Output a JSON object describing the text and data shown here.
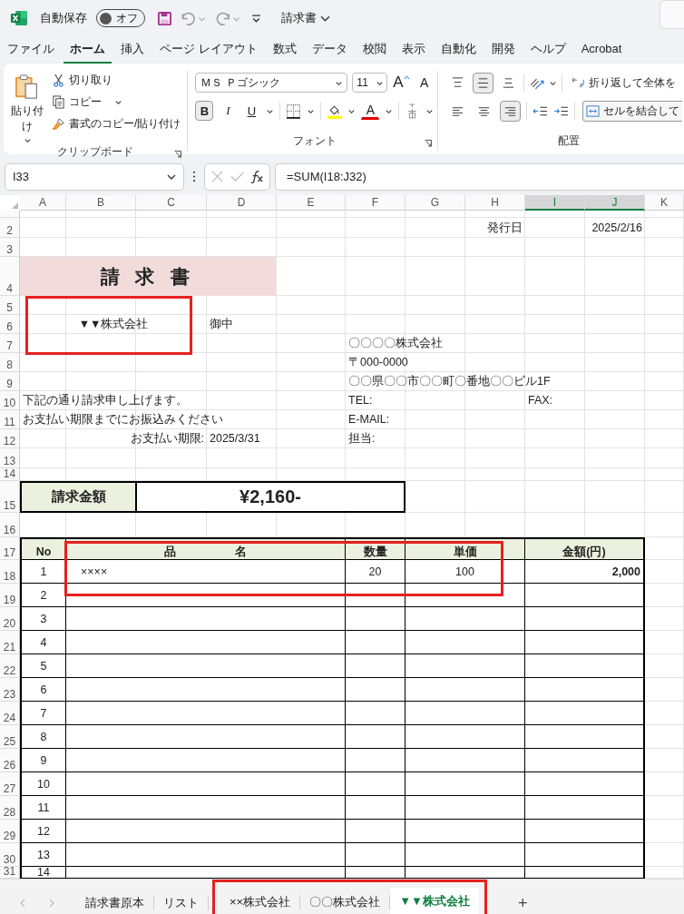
{
  "title_bar": {
    "autosave_label": "自動保存",
    "autosave": {
      "label": "オフ",
      "on": false
    },
    "document_title": "請求書"
  },
  "menu_tabs": [
    {
      "label": "ファイル",
      "selected": false
    },
    {
      "label": "ホーム",
      "selected": true
    },
    {
      "label": "挿入",
      "selected": false
    },
    {
      "label": "ページ レイアウト",
      "selected": false
    },
    {
      "label": "数式",
      "selected": false
    },
    {
      "label": "データ",
      "selected": false
    },
    {
      "label": "校閲",
      "selected": false
    },
    {
      "label": "表示",
      "selected": false
    },
    {
      "label": "自動化",
      "selected": false
    },
    {
      "label": "開発",
      "selected": false
    },
    {
      "label": "ヘルプ",
      "selected": false
    },
    {
      "label": "Acrobat",
      "selected": false
    }
  ],
  "ribbon": {
    "clipboard": {
      "paste": "貼り付け",
      "cut": "切り取り",
      "copy": "コピー",
      "format_painter": "書式のコピー/貼り付け",
      "label": "クリップボード"
    },
    "font": {
      "name": "ＭＳ Ｐゴシック",
      "size": "11",
      "grow": "A",
      "shrink": "A",
      "font_color": "A",
      "label": "フォント",
      "styles": [
        {
          "kind": "bold",
          "label": "B",
          "selected": true
        },
        {
          "kind": "italic",
          "label": "I",
          "selected": false
        },
        {
          "kind": "underline",
          "label": "U",
          "selected": false
        }
      ]
    },
    "alignment": {
      "vertical": [
        {
          "kind": "top",
          "selected": false
        },
        {
          "kind": "middle",
          "selected": true
        },
        {
          "kind": "bottom",
          "selected": false
        }
      ],
      "horizontal": [
        {
          "kind": "left",
          "selected": false
        },
        {
          "kind": "center",
          "selected": false
        },
        {
          "kind": "right",
          "selected": true
        }
      ],
      "wrap_text": "折り返して全体を",
      "merge_center": "セルを結合して",
      "label": "配置"
    }
  },
  "formula_bar": {
    "name_box": "I33",
    "formula": "=SUM(I18:J32)"
  },
  "sheet": {
    "columns": [
      {
        "label": "A",
        "selected": false
      },
      {
        "label": "B",
        "selected": false
      },
      {
        "label": "C",
        "selected": false
      },
      {
        "label": "D",
        "selected": false
      },
      {
        "label": "E",
        "selected": false
      },
      {
        "label": "F",
        "selected": false
      },
      {
        "label": "G",
        "selected": false
      },
      {
        "label": "H",
        "selected": false
      },
      {
        "label": "I",
        "selected": true
      },
      {
        "label": "J",
        "selected": true
      },
      {
        "label": "K",
        "selected": false
      }
    ],
    "rows": [
      "2",
      "3",
      "4",
      "5",
      "6",
      "7",
      "8",
      "9",
      "10",
      "11",
      "12",
      "13",
      "14",
      "15",
      "16",
      "17",
      "18",
      "19",
      "20",
      "21",
      "22",
      "23",
      "24",
      "25",
      "26",
      "27",
      "28",
      "29",
      "30",
      "31"
    ]
  },
  "invoice": {
    "issue_date_label": "発行日",
    "issue_date": "2025/2/16",
    "title": "請 求 書",
    "recipient": {
      "name": "▼▼株式会社",
      "framed": true
    },
    "honorific": "御中",
    "issuer": {
      "company": "〇〇〇〇株式会社",
      "postal": "〒000-0000",
      "address": "〇〇県〇〇市〇〇町〇番地〇〇ビル1F",
      "tel": "TEL:",
      "fax": "FAX:",
      "email": "E-MAIL:",
      "contact": "担当:"
    },
    "message": [
      "下記の通り請求申し上げます。",
      "お支払い期限までにお振込みください"
    ],
    "due_label": "お支払い期限:",
    "due_date": "2025/3/31",
    "total_label": "請求金額",
    "total": "¥2,160-",
    "items": {
      "columns": [
        "No",
        "品　　　　　名",
        "数量",
        "単価",
        "金額(円)"
      ],
      "rows": [
        {
          "no": "1",
          "name": "××××",
          "qty": "20",
          "unit_price": "100",
          "amount": "2,000",
          "framed": true
        },
        {
          "no": "2"
        },
        {
          "no": "3"
        },
        {
          "no": "4"
        },
        {
          "no": "5"
        },
        {
          "no": "6"
        },
        {
          "no": "7"
        },
        {
          "no": "8"
        },
        {
          "no": "9"
        },
        {
          "no": "10"
        },
        {
          "no": "11"
        },
        {
          "no": "12"
        },
        {
          "no": "13"
        },
        {
          "no": "14"
        }
      ]
    }
  },
  "sheet_tabs": [
    {
      "label": "請求書原本",
      "selected": false,
      "framed": false
    },
    {
      "label": "リスト",
      "selected": false,
      "framed": false
    },
    {
      "label": "××株式会社",
      "selected": false,
      "framed": true
    },
    {
      "label": "〇〇株式会社",
      "selected": false,
      "framed": true
    },
    {
      "label": "▼▼株式会社",
      "selected": true,
      "framed": true
    }
  ],
  "add_sheet": "+"
}
